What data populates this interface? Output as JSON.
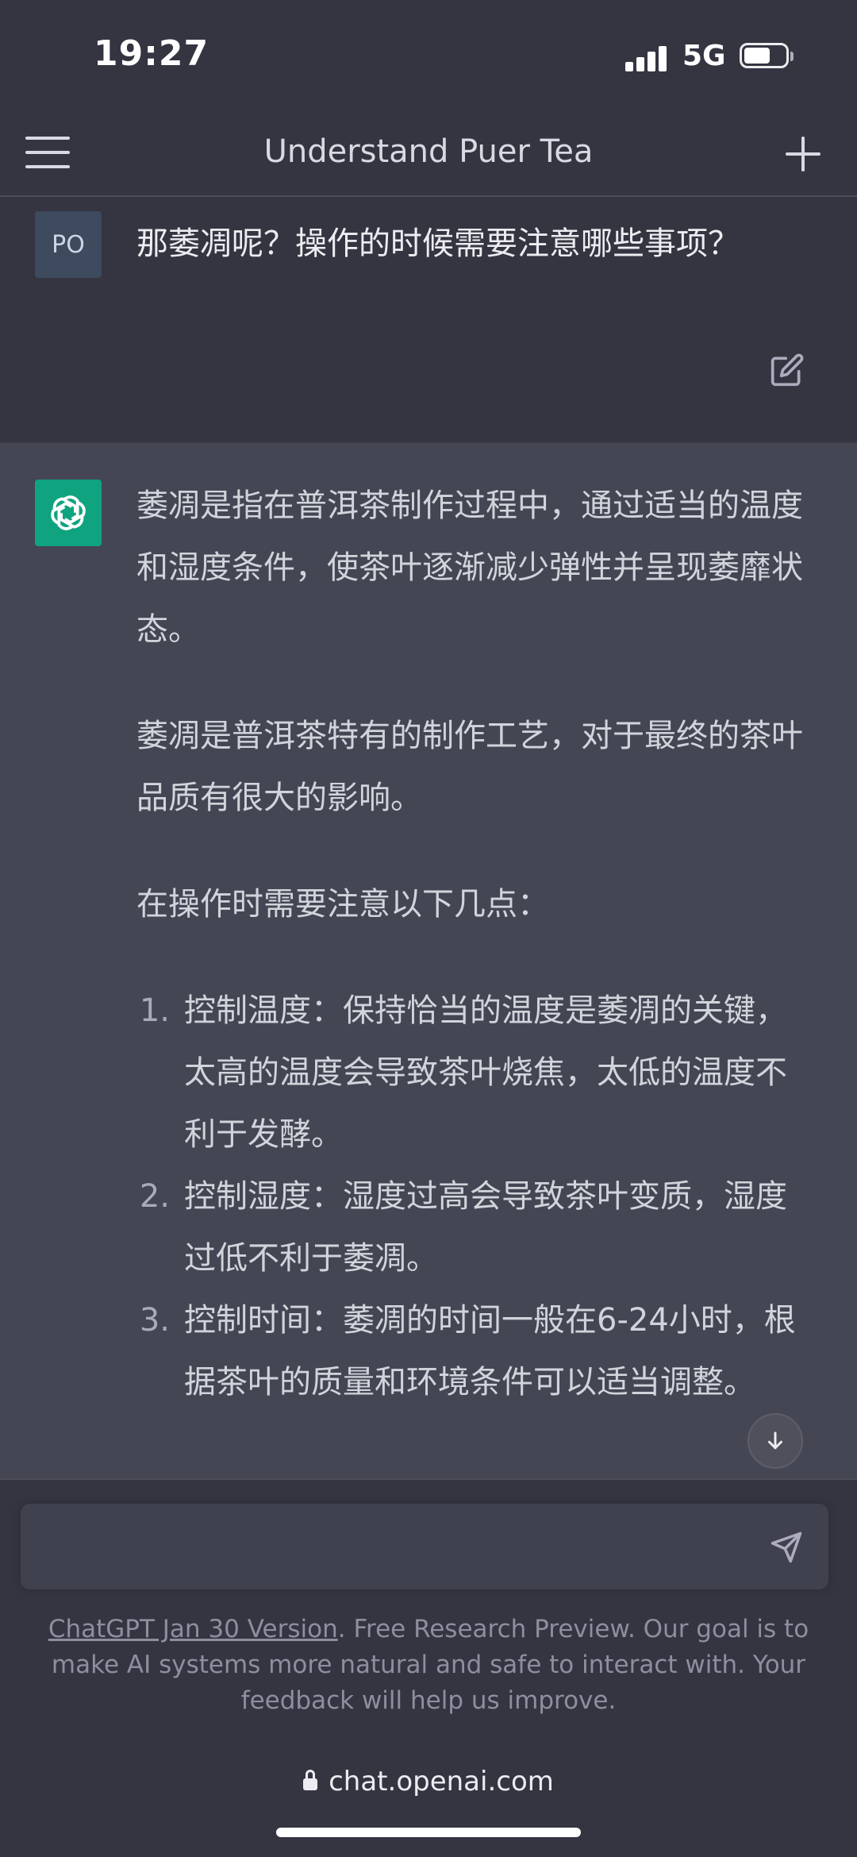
{
  "status": {
    "time": "19:27",
    "network": "5G"
  },
  "header": {
    "title": "Understand Puer Tea"
  },
  "user_message": {
    "avatar": "PO",
    "text": "那萎凋呢？操作的时候需要注意哪些事项？"
  },
  "assistant_message": {
    "paragraphs": [
      "萎凋是指在普洱茶制作过程中，通过适当的温度和湿度条件，使茶叶逐渐减少弹性并呈现萎靡状态。",
      "萎凋是普洱茶特有的制作工艺，对于最终的茶叶品质有很大的影响。",
      "在操作时需要注意以下几点："
    ],
    "list": [
      {
        "num": "1.",
        "text": "控制温度：保持恰当的温度是萎凋的关键，太高的温度会导致茶叶烧焦，太低的温度不利于发酵。"
      },
      {
        "num": "2.",
        "text": "控制湿度：湿度过高会导致茶叶变质，湿度过低不利于萎凋。"
      },
      {
        "num": "3.",
        "text": "控制时间：萎凋的时间一般在6-24小时，根据茶叶的质量和环境条件可以适当调整。"
      }
    ]
  },
  "footer": {
    "version_link": "ChatGPT Jan 30 Version",
    "disclaimer": ". Free Research Preview. Our goal is to make AI systems more natural and safe to interact with. Your feedback will help us improve.",
    "url": "chat.openai.com"
  },
  "colors": {
    "background": "#343541",
    "assistant_bg": "#444654",
    "brand": "#10a37f"
  },
  "icons": [
    "menu-icon",
    "plus-icon",
    "edit-icon",
    "openai-logo-icon",
    "arrow-down-icon",
    "send-icon",
    "lock-icon"
  ]
}
